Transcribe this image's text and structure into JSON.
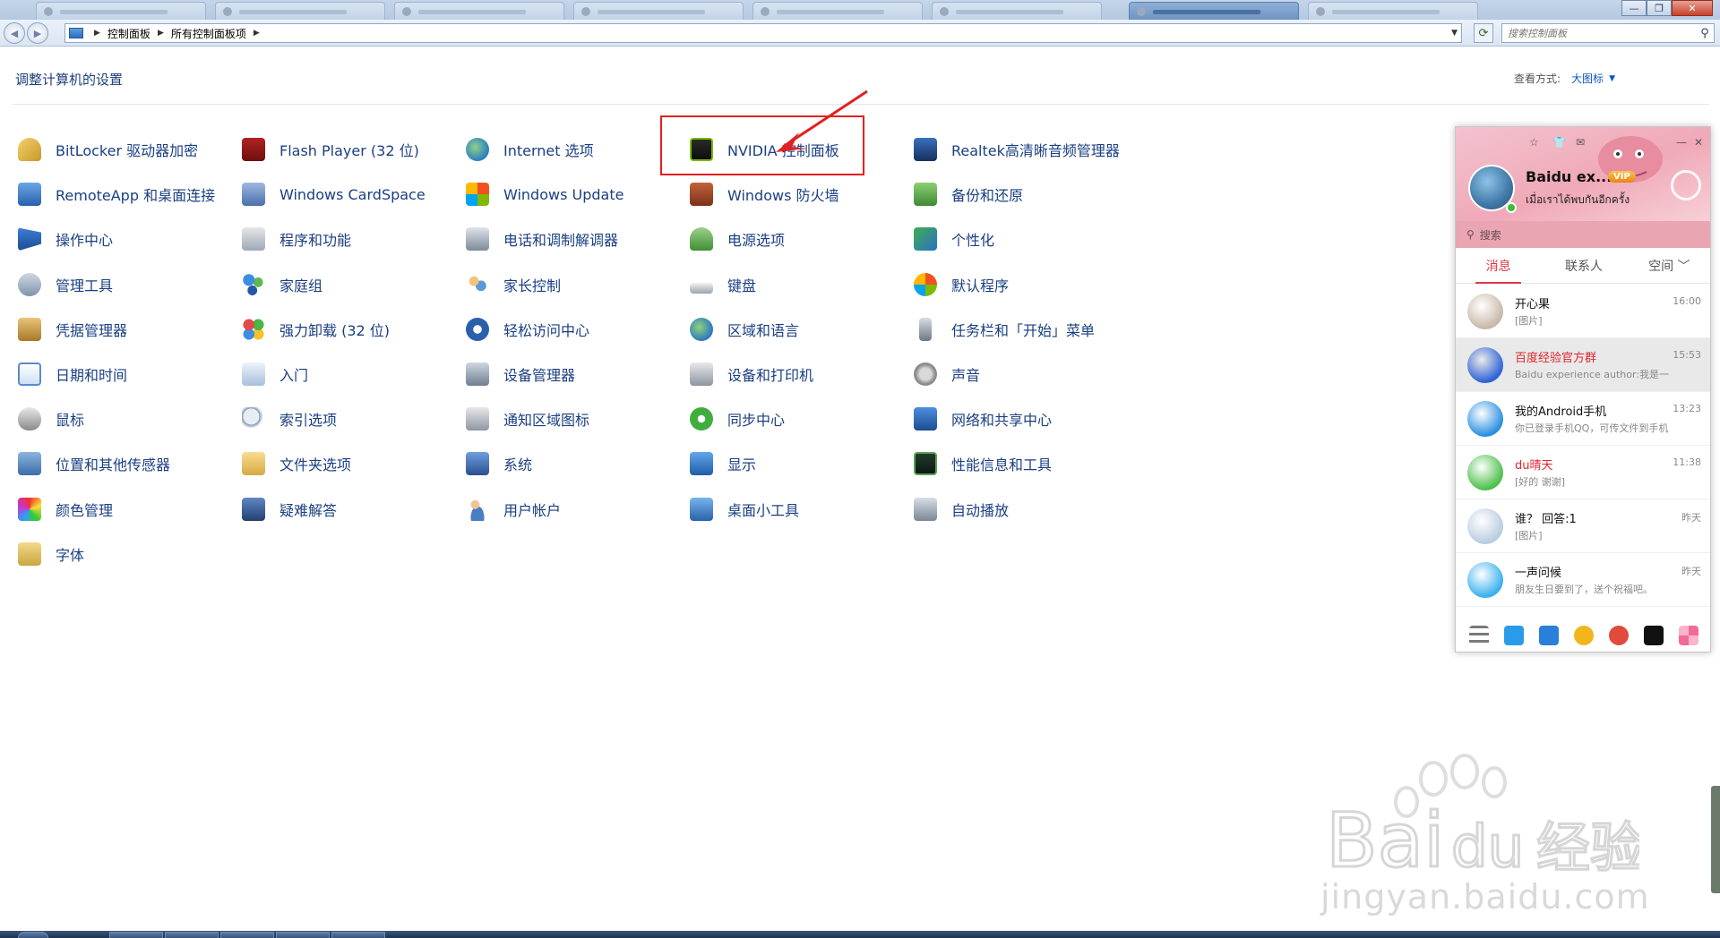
{
  "window": {
    "addr_path": [
      "控制面板",
      "所有控制面板项"
    ],
    "search_placeholder": "搜索控制面板",
    "minimize": "—",
    "restore": "❐",
    "close": "✕"
  },
  "header": {
    "title": "调整计算机的设置",
    "view_by_label": "查看方式:",
    "view_by_value": "大图标"
  },
  "items": [
    {
      "label": "BitLocker 驱动器加密",
      "icon": "bitlocker-icon"
    },
    {
      "label": "RemoteApp 和桌面连接",
      "icon": "remoteapp-icon"
    },
    {
      "label": "操作中心",
      "icon": "action-center-icon"
    },
    {
      "label": "管理工具",
      "icon": "admin-tools-icon"
    },
    {
      "label": "凭据管理器",
      "icon": "credential-manager-icon"
    },
    {
      "label": "日期和时间",
      "icon": "date-time-icon"
    },
    {
      "label": "鼠标",
      "icon": "mouse-icon"
    },
    {
      "label": "位置和其他传感器",
      "icon": "location-sensors-icon"
    },
    {
      "label": "颜色管理",
      "icon": "color-management-icon"
    },
    {
      "label": "字体",
      "icon": "fonts-icon"
    },
    {
      "label": "Flash Player (32 位)",
      "icon": "flash-player-icon"
    },
    {
      "label": "Windows CardSpace",
      "icon": "cardspace-icon"
    },
    {
      "label": "程序和功能",
      "icon": "programs-features-icon"
    },
    {
      "label": "家庭组",
      "icon": "homegroup-icon"
    },
    {
      "label": "强力卸载 (32 位)",
      "icon": "uninstaller-icon"
    },
    {
      "label": "入门",
      "icon": "getting-started-icon"
    },
    {
      "label": "索引选项",
      "icon": "indexing-options-icon"
    },
    {
      "label": "文件夹选项",
      "icon": "folder-options-icon"
    },
    {
      "label": "疑难解答",
      "icon": "troubleshooting-icon"
    },
    {
      "label": "Internet 选项",
      "icon": "internet-options-icon"
    },
    {
      "label": "Windows Update",
      "icon": "windows-update-icon"
    },
    {
      "label": "电话和调制解调器",
      "icon": "phone-modem-icon"
    },
    {
      "label": "家长控制",
      "icon": "parental-controls-icon"
    },
    {
      "label": "轻松访问中心",
      "icon": "ease-of-access-icon"
    },
    {
      "label": "设备管理器",
      "icon": "device-manager-icon"
    },
    {
      "label": "通知区域图标",
      "icon": "notification-area-icon"
    },
    {
      "label": "系统",
      "icon": "system-icon"
    },
    {
      "label": "用户帐户",
      "icon": "user-accounts-icon"
    },
    {
      "label": "NVIDIA 控制面板",
      "icon": "nvidia-icon"
    },
    {
      "label": "Windows 防火墙",
      "icon": "firewall-icon"
    },
    {
      "label": "电源选项",
      "icon": "power-options-icon"
    },
    {
      "label": "键盘",
      "icon": "keyboard-icon"
    },
    {
      "label": "区域和语言",
      "icon": "region-language-icon"
    },
    {
      "label": "设备和打印机",
      "icon": "devices-printers-icon"
    },
    {
      "label": "同步中心",
      "icon": "sync-center-icon"
    },
    {
      "label": "显示",
      "icon": "display-icon"
    },
    {
      "label": "桌面小工具",
      "icon": "desktop-gadgets-icon"
    },
    {
      "label": "Realtek高清晰音频管理器",
      "icon": "realtek-audio-icon"
    },
    {
      "label": "备份和还原",
      "icon": "backup-restore-icon"
    },
    {
      "label": "个性化",
      "icon": "personalization-icon"
    },
    {
      "label": "默认程序",
      "icon": "default-programs-icon"
    },
    {
      "label": "任务栏和「开始」菜单",
      "icon": "taskbar-start-icon"
    },
    {
      "label": "声音",
      "icon": "sound-icon"
    },
    {
      "label": "网络和共享中心",
      "icon": "network-sharing-icon"
    },
    {
      "label": "性能信息和工具",
      "icon": "performance-icon"
    },
    {
      "label": "自动播放",
      "icon": "autoplay-icon"
    }
  ],
  "qq": {
    "name": "Baidu ex...",
    "vip": "VIP",
    "signature": "เมื่อเราได้พบกันอีกครั้ง",
    "search_placeholder": "搜索",
    "tabs": [
      "消息",
      "联系人",
      "空间 ﹀"
    ],
    "conversations": [
      {
        "name": "开心果",
        "msg": "[图片]",
        "time": "16:00",
        "color": "#c8b9a8",
        "red": false
      },
      {
        "name": "百度经验官方群",
        "msg": "Baidu experience author:我是一",
        "time": "15:53",
        "color": "#2f63d6",
        "red": true
      },
      {
        "name": "我的Android手机",
        "msg": "你已登录手机QQ，可传文件到手机",
        "time": "13:23",
        "color": "#2a8fe0",
        "red": false
      },
      {
        "name": "du晴天",
        "msg": "[好的 谢谢]",
        "time": "11:38",
        "color": "#4cc04a",
        "red": true
      },
      {
        "name": "谁？ 回答:1",
        "msg": "[图片]",
        "time": "昨天",
        "color": "#b9cde0",
        "red": false
      },
      {
        "name": "一声问候",
        "msg": "朋友生日要到了，送个祝福吧。",
        "time": "昨天",
        "color": "#3ab0f0",
        "red": false
      }
    ],
    "bottom_icons": [
      "menu-icon",
      "add-friend-icon",
      "file-transfer-icon",
      "qq-game-icon",
      "qq-penguin-icon",
      "bag-icon",
      "apps-grid-icon"
    ]
  },
  "watermark": {
    "site": "jingyan.baidu.com"
  }
}
